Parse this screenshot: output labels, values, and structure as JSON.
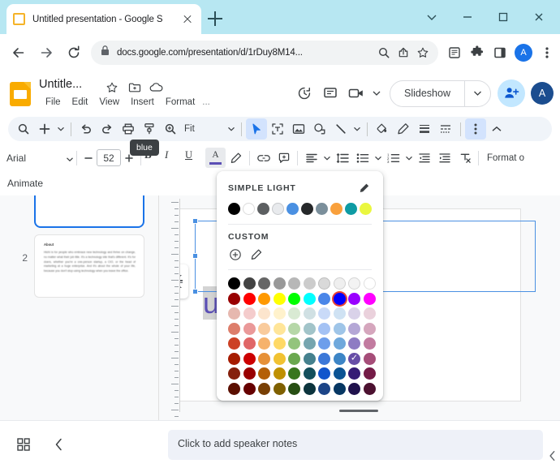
{
  "browser": {
    "tab": {
      "title": "Untitled presentation - Google S",
      "favicon": "slides-favicon",
      "close": "close-icon"
    },
    "new_tab": "+",
    "window_controls": [
      "chevron-down-icon",
      "minimize-icon",
      "maximize-icon",
      "close-icon"
    ],
    "nav": {
      "back": "back-arrow-icon",
      "forward": "forward-arrow-icon",
      "reload": "reload-icon"
    },
    "url": "docs.google.com/presentation/d/1rDuy8M14...",
    "lock": "lock-icon",
    "omni_icons": [
      "zoom-search-icon",
      "share-icon",
      "bookmark-star-icon"
    ],
    "extensions": [
      "reading-list-icon",
      "puzzle-extension-icon",
      "side-panel-icon"
    ],
    "profile_initial": "A",
    "menu": "three-dot-menu-icon"
  },
  "slides": {
    "doc_title": "Untitle...",
    "title_icons": [
      "star-icon",
      "move-to-folder-icon",
      "cloud-saved-icon"
    ],
    "menu_items": [
      "File",
      "Edit",
      "View",
      "Insert",
      "Format",
      "..."
    ],
    "header_right_icons": [
      "version-history-icon",
      "comment-icon",
      "present-video-icon"
    ],
    "slideshow_label": "Slideshow",
    "share_label": "share-add-person-icon",
    "avatar_initial": "A"
  },
  "toolbar1": {
    "items": [
      "search-icon",
      "add-slide-icon",
      "undo-icon",
      "redo-icon",
      "print-icon",
      "paint-format-icon",
      "zoom-icon"
    ],
    "zoom_label": "Fit",
    "right_items": [
      "select-cursor-icon",
      "text-box-icon",
      "image-icon",
      "shape-icon",
      "line-icon",
      "fill-color-icon",
      "border-color-icon",
      "border-weight-icon",
      "border-dash-icon",
      "more-options-icon",
      "collapse-toolbar-icon"
    ]
  },
  "toolbar2": {
    "font_name": "Arial",
    "font_size": "52",
    "decrease": "minus-icon",
    "increase": "plus-icon",
    "bold": "B",
    "italic": "I",
    "underline": "U",
    "text_color": "A",
    "highlight": "highlight-pen-icon",
    "link": "link-icon",
    "comment": "add-comment-icon",
    "align": "align-left-icon",
    "line_spacing": "line-spacing-icon",
    "bulleted_list": "bulleted-list-icon",
    "numbered_list": "numbered-list-icon",
    "decrease_indent": "decrease-indent-icon",
    "increase_indent": "increase-indent-icon",
    "clear_formatting": "clear-formatting-icon",
    "format_options": "Format o"
  },
  "animate": {
    "label": "Animate"
  },
  "filmstrip": {
    "slides": [
      {
        "number": "",
        "selected": true,
        "title": "",
        "body": ""
      },
      {
        "number": "2",
        "selected": false,
        "title": "About",
        "body": "Hichi is for people who embrace new technology and thrive on change, no matter what their job title. It's a technology site that's different. It's for doers, whether you're a one-person startup, a CIO, or the head of marketing at a huge enterprise. And it's about the whole of your life, because you don't stop using technology when you leave the office."
      }
    ]
  },
  "canvas": {
    "slide_text": "uides",
    "slide_text_color": "#5b4fb5",
    "selection_border_color": "#4a90e2"
  },
  "color_picker": {
    "theme_section_label": "SIMPLE LIGHT",
    "theme_edit_icon": "pencil-icon",
    "theme_colors": [
      "#000000",
      "#ffffff",
      "#5c5f61",
      "#e8eaed",
      "#4a90e2",
      "#26282a",
      "#7b8f9b",
      "#f9a03c",
      "#0e9ba4",
      "#eaf73f"
    ],
    "custom_section_label": "CUSTOM",
    "custom_add_icon": "add-circle-icon",
    "custom_eyedropper_icon": "eyedropper-icon",
    "tooltip": "blue",
    "selected_color_name": "blue",
    "grid": [
      [
        "#000000",
        "#434343",
        "#666666",
        "#999999",
        "#b7b7b7",
        "#cccccc",
        "#d9d9d9",
        "#efefef",
        "#f3f3f3",
        "#ffffff"
      ],
      [
        "#980000",
        "#ff0000",
        "#ff9900",
        "#ffff00",
        "#00ff00",
        "#00ffff",
        "#4a86e8",
        "#0000ff",
        "#9900ff",
        "#ff00ff"
      ],
      [
        "#e6b8af",
        "#f4cccc",
        "#fce5cd",
        "#fff2cc",
        "#d9ead3",
        "#d0e0e3",
        "#c9daf8",
        "#cfe2f3",
        "#d9d2e9",
        "#ead1dc"
      ],
      [
        "#dd7e6b",
        "#ea9999",
        "#f9cb9c",
        "#ffe599",
        "#b6d7a8",
        "#a2c4c9",
        "#a4c2f4",
        "#9fc5e8",
        "#b4a7d6",
        "#d5a6bd"
      ],
      [
        "#cc4125",
        "#e06666",
        "#f6b26b",
        "#ffd966",
        "#93c47d",
        "#76a5af",
        "#6d9eeb",
        "#6fa8dc",
        "#8e7cc3",
        "#c27ba0"
      ],
      [
        "#a61c00",
        "#cc0000",
        "#e69138",
        "#f1c232",
        "#6aa84f",
        "#45818e",
        "#3c78d8",
        "#3d85c6",
        "#674ea7",
        "#a64d79"
      ],
      [
        "#85200c",
        "#990000",
        "#b45f06",
        "#bf9000",
        "#38761d",
        "#134f5c",
        "#1155cc",
        "#0b5394",
        "#351c75",
        "#741b47"
      ],
      [
        "#5b0f00",
        "#660000",
        "#783f04",
        "#7f6000",
        "#274e13",
        "#0c343d",
        "#1c4587",
        "#073763",
        "#20124d",
        "#4c1130"
      ]
    ],
    "ringed_cell": {
      "row": 1,
      "col": 7
    },
    "checked_cell": {
      "row": 5,
      "col": 8
    }
  },
  "bottom": {
    "grid_view_icon": "grid-view-icon",
    "collapse_icon": "chevron-left-icon",
    "notes_placeholder": "Click to add speaker notes",
    "expand_right_icon": "chevron-left-small-icon"
  }
}
